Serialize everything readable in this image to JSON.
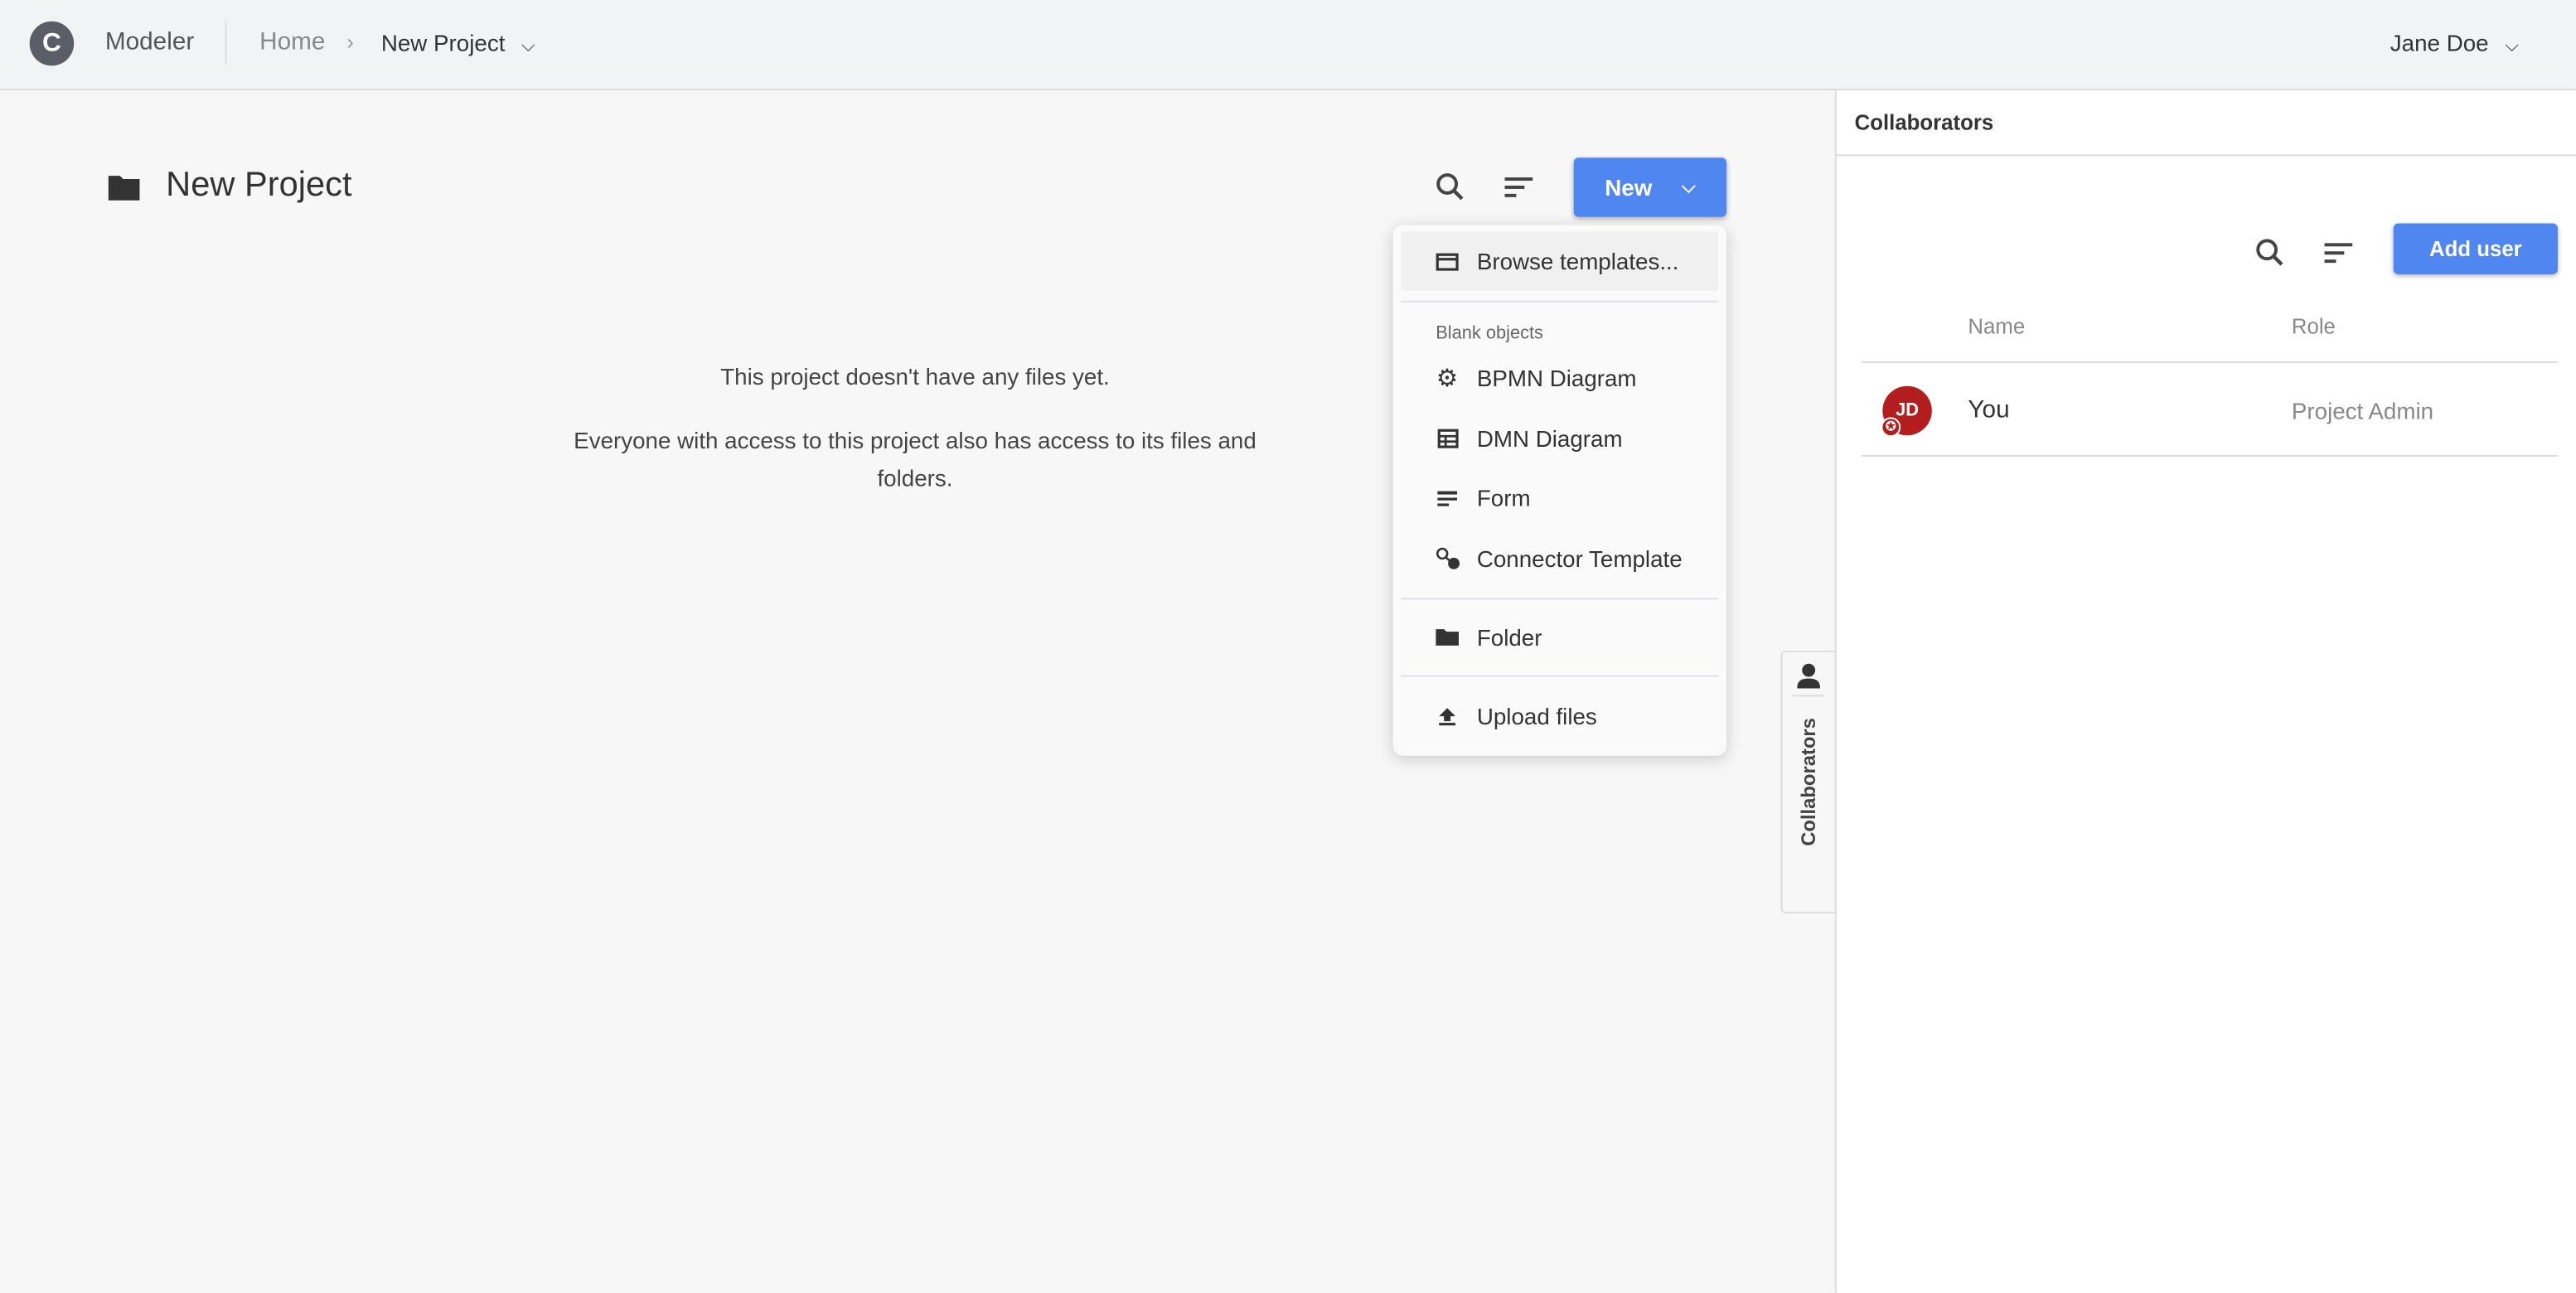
{
  "header": {
    "logo_letter": "C",
    "app_name": "Modeler",
    "breadcrumb": {
      "home": "Home",
      "current": "New Project"
    },
    "user": "Jane Doe"
  },
  "main": {
    "title": "New Project",
    "empty_line1": "This project doesn't have any files yet.",
    "empty_line2": "Everyone with access to this project also has access to its files and folders.",
    "new_button": "New"
  },
  "menu": {
    "browse": "Browse templates...",
    "section": "Blank objects",
    "items": [
      {
        "label": "BPMN Diagram",
        "icon": "bpmn-gear-icon"
      },
      {
        "label": "DMN Diagram",
        "icon": "table-icon"
      },
      {
        "label": "Form",
        "icon": "form-icon"
      },
      {
        "label": "Connector Template",
        "icon": "connector-icon"
      }
    ],
    "folder": "Folder",
    "upload": "Upload files"
  },
  "collaborators": {
    "title": "Collaborators",
    "add_user": "Add user",
    "columns": [
      "Name",
      "Role"
    ],
    "rows": [
      {
        "initials": "JD",
        "name": "You",
        "role": "Project Admin"
      }
    ],
    "tab_label": "Collaborators"
  },
  "colors": {
    "primary": "#4f86f0",
    "avatar": "#b31d1d"
  }
}
